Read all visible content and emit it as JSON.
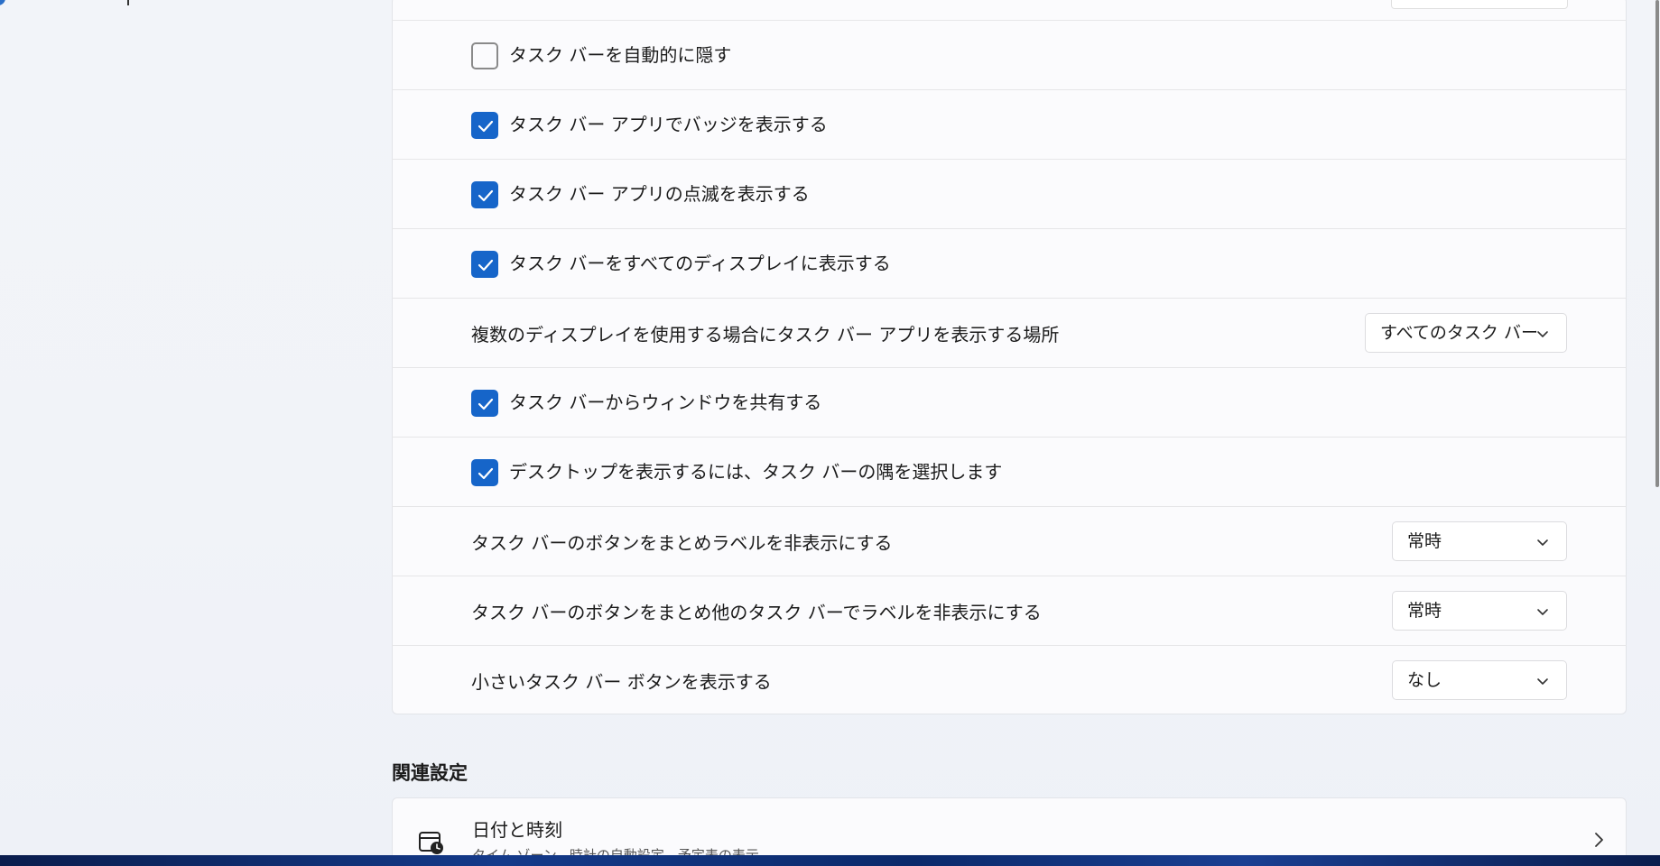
{
  "settings": {
    "rows": [
      {
        "type": "checkbox",
        "checked": false,
        "label": "タスク バーを自動的に隠す"
      },
      {
        "type": "checkbox",
        "checked": true,
        "label": "タスク バー アプリでバッジを表示する"
      },
      {
        "type": "checkbox",
        "checked": true,
        "label": "タスク バー アプリの点滅を表示する"
      },
      {
        "type": "checkbox",
        "checked": true,
        "label": "タスク バーをすべてのディスプレイに表示する"
      },
      {
        "type": "select",
        "label": "複数のディスプレイを使用する場合にタスク バー アプリを表示する場所",
        "value": "すべてのタスク バー"
      },
      {
        "type": "checkbox",
        "checked": true,
        "label": "タスク バーからウィンドウを共有する"
      },
      {
        "type": "checkbox",
        "checked": true,
        "label": "デスクトップを表示するには、タスク バーの隅を選択します"
      },
      {
        "type": "select",
        "label": "タスク バーのボタンをまとめラベルを非表示にする",
        "value": "常時"
      },
      {
        "type": "select",
        "label": "タスク バーのボタンをまとめ他のタスク バーでラベルを非表示にする",
        "value": "常時"
      },
      {
        "type": "select",
        "label": "小さいタスク バー ボタンを表示する",
        "value": "なし"
      }
    ]
  },
  "related": {
    "heading": "関連設定",
    "items": [
      {
        "title": "日付と時刻",
        "subtitle": "タイム ゾーン、時計の自動設定、予定表の表示",
        "icon": "calendar-clock-icon"
      }
    ]
  },
  "colors": {
    "accent": "#1665c9"
  }
}
